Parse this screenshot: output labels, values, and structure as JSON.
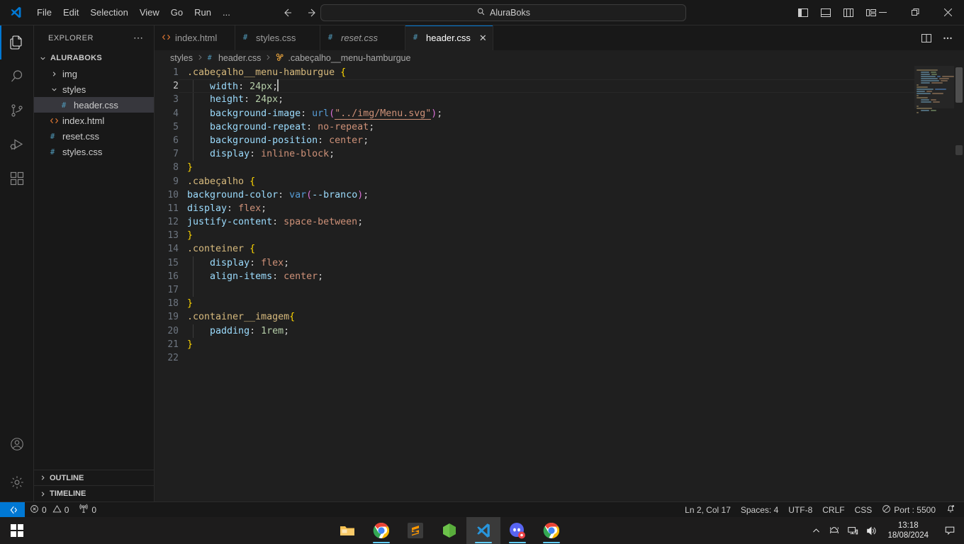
{
  "titlebar": {
    "menus": [
      "File",
      "Edit",
      "Selection",
      "View",
      "Go",
      "Run",
      "..."
    ],
    "command_center_text": "AluraBoks",
    "layout_buttons": [
      "toggle-primary-sidebar",
      "toggle-panel",
      "toggle-secondary-sidebar",
      "customize-layout"
    ],
    "window_controls": [
      "minimize",
      "restore",
      "close"
    ]
  },
  "activitybar": {
    "items": [
      {
        "name": "explorer",
        "active": true
      },
      {
        "name": "search",
        "active": false
      },
      {
        "name": "source-control",
        "active": false
      },
      {
        "name": "run-and-debug",
        "active": false
      },
      {
        "name": "extensions",
        "active": false
      }
    ],
    "bottom": [
      {
        "name": "accounts"
      },
      {
        "name": "manage-settings"
      }
    ]
  },
  "sidebar": {
    "title": "EXPLORER",
    "more_actions": "⋯",
    "root_folder": "ALURABOKS",
    "tree": [
      {
        "label": "img",
        "type": "folder",
        "expanded": false,
        "indent": 1,
        "selected": false
      },
      {
        "label": "styles",
        "type": "folder",
        "expanded": true,
        "indent": 1,
        "selected": false
      },
      {
        "label": "header.css",
        "type": "css",
        "indent": 2,
        "selected": true
      },
      {
        "label": "index.html",
        "type": "html",
        "indent": 1,
        "selected": false
      },
      {
        "label": "reset.css",
        "type": "css",
        "indent": 1,
        "selected": false
      },
      {
        "label": "styles.css",
        "type": "css",
        "indent": 1,
        "selected": false
      }
    ],
    "panels": [
      "OUTLINE",
      "TIMELINE"
    ]
  },
  "editor": {
    "tabs": [
      {
        "label": "index.html",
        "icon": "html-icon",
        "active": false,
        "preview": false,
        "closable": false
      },
      {
        "label": "styles.css",
        "icon": "css-icon",
        "active": false,
        "preview": false,
        "closable": false
      },
      {
        "label": "reset.css",
        "icon": "css-icon",
        "active": false,
        "preview": true,
        "closable": false
      },
      {
        "label": "header.css",
        "icon": "css-icon",
        "active": true,
        "preview": false,
        "closable": true
      }
    ],
    "tab_close_label": "✕",
    "actions": [
      "split-editor-right",
      "more-editor-actions"
    ],
    "breadcrumb": [
      {
        "label": "styles",
        "icon": "folder"
      },
      {
        "label": "header.css",
        "icon": "css-icon"
      },
      {
        "label": ".cabeçalho__menu-hamburgue",
        "icon": "css-selector-icon"
      }
    ],
    "lines": [
      {
        "n": 1,
        "tokens": [
          {
            "t": ".cabeçalho__menu-hamburgue ",
            "c": "t-sel"
          },
          {
            "t": "{",
            "c": "t-brace"
          }
        ]
      },
      {
        "n": 2,
        "current": true,
        "indent": 1,
        "tokens": [
          {
            "t": "    ",
            "c": "t-punc"
          },
          {
            "t": "width",
            "c": "t-prop"
          },
          {
            "t": ": ",
            "c": "t-punc"
          },
          {
            "t": "24px",
            "c": "t-num"
          },
          {
            "t": ";",
            "c": "t-punc"
          }
        ],
        "cursor": true
      },
      {
        "n": 3,
        "indent": 1,
        "tokens": [
          {
            "t": "    ",
            "c": "t-punc"
          },
          {
            "t": "height",
            "c": "t-prop"
          },
          {
            "t": ": ",
            "c": "t-punc"
          },
          {
            "t": "24px",
            "c": "t-num"
          },
          {
            "t": ";",
            "c": "t-punc"
          }
        ]
      },
      {
        "n": 4,
        "indent": 1,
        "tokens": [
          {
            "t": "    ",
            "c": "t-punc"
          },
          {
            "t": "background-image",
            "c": "t-prop"
          },
          {
            "t": ": ",
            "c": "t-punc"
          },
          {
            "t": "url",
            "c": "t-fn"
          },
          {
            "t": "(",
            "c": "t-paren"
          },
          {
            "t": "\"../img/Menu.svg\"",
            "c": "t-str"
          },
          {
            "t": ")",
            "c": "t-paren"
          },
          {
            "t": ";",
            "c": "t-punc"
          }
        ]
      },
      {
        "n": 5,
        "indent": 1,
        "tokens": [
          {
            "t": "    ",
            "c": "t-punc"
          },
          {
            "t": "background-repeat",
            "c": "t-prop"
          },
          {
            "t": ": ",
            "c": "t-punc"
          },
          {
            "t": "no-repeat",
            "c": "t-val"
          },
          {
            "t": ";",
            "c": "t-punc"
          }
        ]
      },
      {
        "n": 6,
        "indent": 1,
        "tokens": [
          {
            "t": "    ",
            "c": "t-punc"
          },
          {
            "t": "background-position",
            "c": "t-prop"
          },
          {
            "t": ": ",
            "c": "t-punc"
          },
          {
            "t": "center",
            "c": "t-val"
          },
          {
            "t": ";",
            "c": "t-punc"
          }
        ]
      },
      {
        "n": 7,
        "indent": 1,
        "tokens": [
          {
            "t": "    ",
            "c": "t-punc"
          },
          {
            "t": "display",
            "c": "t-prop"
          },
          {
            "t": ": ",
            "c": "t-punc"
          },
          {
            "t": "inline-block",
            "c": "t-val"
          },
          {
            "t": ";",
            "c": "t-punc"
          }
        ]
      },
      {
        "n": 8,
        "tokens": [
          {
            "t": "}",
            "c": "t-brace"
          }
        ]
      },
      {
        "n": 9,
        "tokens": [
          {
            "t": ".cabeçalho ",
            "c": "t-sel"
          },
          {
            "t": "{",
            "c": "t-brace"
          }
        ]
      },
      {
        "n": 10,
        "tokens": [
          {
            "t": "background-color",
            "c": "t-prop"
          },
          {
            "t": ": ",
            "c": "t-punc"
          },
          {
            "t": "var",
            "c": "t-fn"
          },
          {
            "t": "(",
            "c": "t-paren"
          },
          {
            "t": "--branco",
            "c": "t-var"
          },
          {
            "t": ")",
            "c": "t-paren"
          },
          {
            "t": ";",
            "c": "t-punc"
          }
        ]
      },
      {
        "n": 11,
        "tokens": [
          {
            "t": "display",
            "c": "t-prop"
          },
          {
            "t": ": ",
            "c": "t-punc"
          },
          {
            "t": "flex",
            "c": "t-val"
          },
          {
            "t": ";",
            "c": "t-punc"
          }
        ]
      },
      {
        "n": 12,
        "tokens": [
          {
            "t": "justify-content",
            "c": "t-prop"
          },
          {
            "t": ": ",
            "c": "t-punc"
          },
          {
            "t": "space-between",
            "c": "t-val"
          },
          {
            "t": ";",
            "c": "t-punc"
          }
        ]
      },
      {
        "n": 13,
        "tokens": [
          {
            "t": "}",
            "c": "t-brace"
          }
        ]
      },
      {
        "n": 14,
        "tokens": [
          {
            "t": ".conteiner ",
            "c": "t-sel"
          },
          {
            "t": "{",
            "c": "t-brace"
          }
        ]
      },
      {
        "n": 15,
        "indent": 1,
        "tokens": [
          {
            "t": "    ",
            "c": "t-punc"
          },
          {
            "t": "display",
            "c": "t-prop"
          },
          {
            "t": ": ",
            "c": "t-punc"
          },
          {
            "t": "flex",
            "c": "t-val"
          },
          {
            "t": ";",
            "c": "t-punc"
          }
        ]
      },
      {
        "n": 16,
        "indent": 1,
        "tokens": [
          {
            "t": "    ",
            "c": "t-punc"
          },
          {
            "t": "align-items",
            "c": "t-prop"
          },
          {
            "t": ": ",
            "c": "t-punc"
          },
          {
            "t": "center",
            "c": "t-val"
          },
          {
            "t": ";",
            "c": "t-punc"
          }
        ]
      },
      {
        "n": 17,
        "indent": 1,
        "tokens": []
      },
      {
        "n": 18,
        "tokens": [
          {
            "t": "}",
            "c": "t-brace"
          }
        ]
      },
      {
        "n": 19,
        "tokens": [
          {
            "t": ".container__imagem",
            "c": "t-sel"
          },
          {
            "t": "{",
            "c": "t-brace"
          }
        ]
      },
      {
        "n": 20,
        "indent": 1,
        "tokens": [
          {
            "t": "    ",
            "c": "t-punc"
          },
          {
            "t": "padding",
            "c": "t-prop"
          },
          {
            "t": ": ",
            "c": "t-punc"
          },
          {
            "t": "1rem",
            "c": "t-num"
          },
          {
            "t": ";",
            "c": "t-punc"
          }
        ]
      },
      {
        "n": 21,
        "tokens": [
          {
            "t": "}",
            "c": "t-brace"
          }
        ]
      },
      {
        "n": 22,
        "tokens": []
      }
    ]
  },
  "statusbar": {
    "remote_label": "remote-indicator",
    "left": [
      {
        "name": "problems-errors",
        "icon": "error-icon",
        "text": "0"
      },
      {
        "name": "problems-warnings",
        "icon": "warning-icon",
        "text": "0"
      },
      {
        "name": "ports",
        "icon": "radio-tower-icon",
        "text": "0"
      }
    ],
    "right": [
      {
        "name": "editor-position",
        "text": "Ln 2, Col 17"
      },
      {
        "name": "editor-indentation",
        "text": "Spaces: 4"
      },
      {
        "name": "editor-encoding",
        "text": "UTF-8"
      },
      {
        "name": "editor-eol",
        "text": "CRLF"
      },
      {
        "name": "editor-language",
        "text": "CSS"
      },
      {
        "name": "live-server-port",
        "text": "Port : 5500",
        "icon": "circle-slash-icon"
      },
      {
        "name": "notifications",
        "icon": "bell-dot-icon",
        "text": ""
      }
    ]
  },
  "taskbar": {
    "start": "start-button",
    "apps": [
      {
        "name": "file-explorer",
        "running": false,
        "active": false
      },
      {
        "name": "google-chrome",
        "running": true,
        "active": false
      },
      {
        "name": "sublime-text",
        "running": false,
        "active": false
      },
      {
        "name": "nodejs",
        "running": false,
        "active": false
      },
      {
        "name": "visual-studio-code",
        "running": true,
        "active": true
      },
      {
        "name": "discord",
        "running": true,
        "active": false
      },
      {
        "name": "google-chrome-2",
        "running": true,
        "active": false
      }
    ],
    "tray": [
      "show-hidden-icons",
      "onedrive-icon",
      "network-icon",
      "volume-icon"
    ],
    "time": "13:18",
    "date": "18/08/2024",
    "notification": "notification-center-icon"
  },
  "colors": {
    "accent": "#0078d4",
    "editor_bg": "#1f1f1f",
    "chrome_bg": "#181818",
    "selected_row": "#37373d",
    "css_icon": "#519aba",
    "html_icon": "#e37933",
    "folder_icon": "#cccccc"
  }
}
